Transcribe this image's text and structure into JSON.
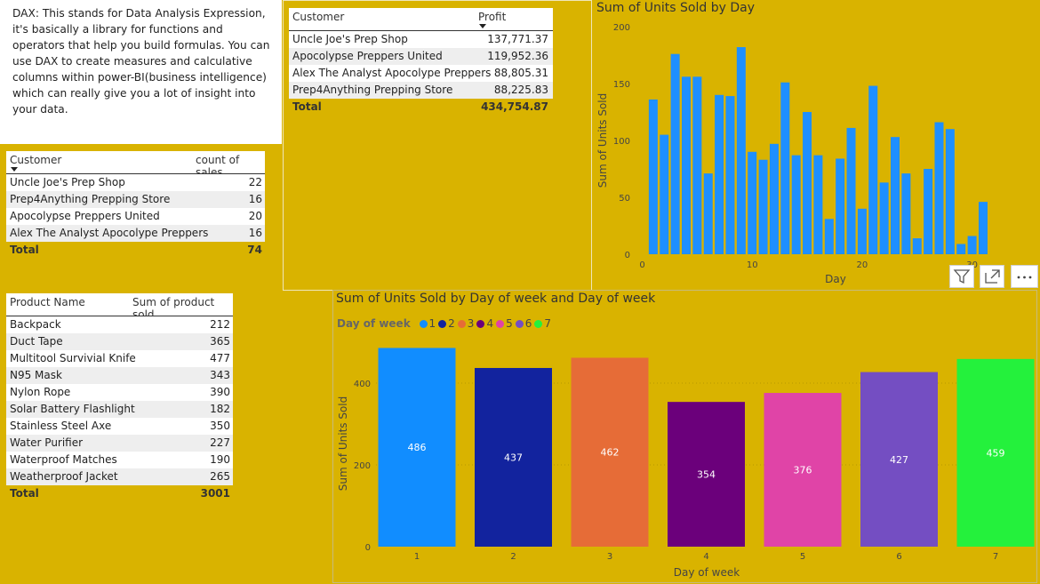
{
  "description_text": "DAX: This stands for Data Analysis Expression, it's basically a library for functions and operators that help you build formulas. You can use DAX to create measures and calculative columns within power-BI(business intelligence) which can really give you a lot of insight into your data.",
  "count_table": {
    "headers": [
      "Customer",
      "count of sales"
    ],
    "rows": [
      {
        "customer": "Uncle Joe's Prep Shop",
        "count": "22"
      },
      {
        "customer": "Prep4Anything Prepping Store",
        "count": "16"
      },
      {
        "customer": "Apocolypse Preppers United",
        "count": "20"
      },
      {
        "customer": "Alex The Analyst Apocolype Preppers",
        "count": "16"
      }
    ],
    "total_label": "Total",
    "total_value": "74"
  },
  "profit_table": {
    "headers": [
      "Customer",
      "Profit"
    ],
    "rows": [
      {
        "customer": "Uncle Joe's Prep Shop",
        "profit": "137,771.37"
      },
      {
        "customer": "Apocolypse Preppers United",
        "profit": "119,952.36"
      },
      {
        "customer": "Alex The Analyst Apocolype Preppers",
        "profit": "88,805.31"
      },
      {
        "customer": "Prep4Anything Prepping Store",
        "profit": "88,225.83"
      }
    ],
    "total_label": "Total",
    "total_value": "434,754.87"
  },
  "product_table": {
    "headers": [
      "Product Name",
      "Sum of product sold"
    ],
    "rows": [
      {
        "product": "Backpack",
        "sold": "212"
      },
      {
        "product": "Duct Tape",
        "sold": "365"
      },
      {
        "product": "Multitool Survivial Knife",
        "sold": "477"
      },
      {
        "product": "N95 Mask",
        "sold": "343"
      },
      {
        "product": "Nylon Rope",
        "sold": "390"
      },
      {
        "product": "Solar Battery Flashlight",
        "sold": "182"
      },
      {
        "product": "Stainless Steel Axe",
        "sold": "350"
      },
      {
        "product": "Water Purifier",
        "sold": "227"
      },
      {
        "product": "Waterproof Matches",
        "sold": "190"
      },
      {
        "product": "Weatherproof Jacket",
        "sold": "265"
      }
    ],
    "total_label": "Total",
    "total_value": "3001"
  },
  "visual_header_icons": [
    "filter-icon",
    "focus-mode-icon",
    "more-options-icon"
  ],
  "colors": {
    "canvas_background": "#d9b300",
    "day_bar_color": "#1e8fff"
  },
  "chart_data": [
    {
      "type": "bar",
      "title": "Sum of Units Sold by Day",
      "xlabel": "Day",
      "ylabel": "Sum of Units Sold",
      "x": [
        1,
        2,
        3,
        4,
        5,
        6,
        7,
        8,
        9,
        10,
        11,
        12,
        13,
        14,
        15,
        16,
        17,
        18,
        19,
        20,
        21,
        22,
        23,
        24,
        25,
        26,
        27,
        28,
        29,
        30
      ],
      "values": [
        136,
        105,
        176,
        156,
        156,
        71,
        140,
        139,
        182,
        90,
        83,
        97,
        151,
        87,
        125,
        87,
        31,
        84,
        111,
        40,
        148,
        63,
        103,
        71,
        14,
        75,
        116,
        110,
        9,
        16,
        46
      ],
      "x_ticks": [
        "0",
        "10",
        "20",
        "30"
      ],
      "y_ticks": [
        "0",
        "50",
        "100",
        "150",
        "200"
      ],
      "ylim": [
        0,
        200
      ],
      "grid": false
    },
    {
      "type": "bar",
      "title": "Sum of Units Sold by Day of week and Day of week",
      "xlabel": "Day of week",
      "ylabel": "Sum of Units Sold",
      "legend_title": "Day of week",
      "legend_position": "top-left",
      "categories": [
        "1",
        "2",
        "3",
        "4",
        "5",
        "6",
        "7"
      ],
      "values": [
        486,
        437,
        462,
        354,
        376,
        427,
        459
      ],
      "colors": [
        "#118dff",
        "#12239e",
        "#e66c37",
        "#6b007b",
        "#e044a7",
        "#744ec2",
        "#24f13c"
      ],
      "y_ticks": [
        "0",
        "200",
        "400"
      ],
      "ylim": [
        0,
        500
      ],
      "data_labels": true,
      "grid": true
    }
  ]
}
